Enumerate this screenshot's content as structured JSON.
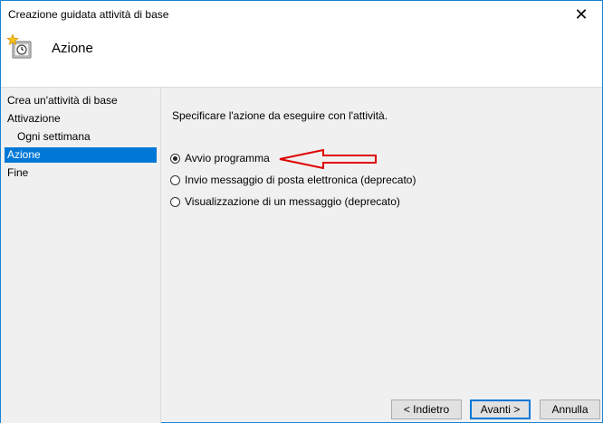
{
  "window": {
    "title": "Creazione guidata attività di base",
    "close_glyph": "✕"
  },
  "header": {
    "title": "Azione",
    "icon": "task-scheduler-icon"
  },
  "sidebar": {
    "items": [
      {
        "label": "Crea un'attività di base",
        "active": false
      },
      {
        "label": "Attivazione",
        "active": false
      },
      {
        "label": "Ogni settimana",
        "active": false
      },
      {
        "label": "Azione",
        "active": true
      },
      {
        "label": "Fine",
        "active": false
      }
    ]
  },
  "main": {
    "instruction": "Specificare l'azione da eseguire con l'attività.",
    "options": [
      {
        "label": "Avvio programma",
        "checked": true
      },
      {
        "label": "Invio messaggio di posta elettronica (deprecato)",
        "checked": false
      },
      {
        "label": "Visualizzazione di un messaggio (deprecato)",
        "checked": false
      }
    ],
    "annotation_color": "#e00000"
  },
  "buttons": {
    "back": "< Indietro",
    "next": "Avanti >",
    "cancel": "Annulla"
  },
  "colors": {
    "accent": "#0078d7",
    "window_border": "#1883d7"
  }
}
